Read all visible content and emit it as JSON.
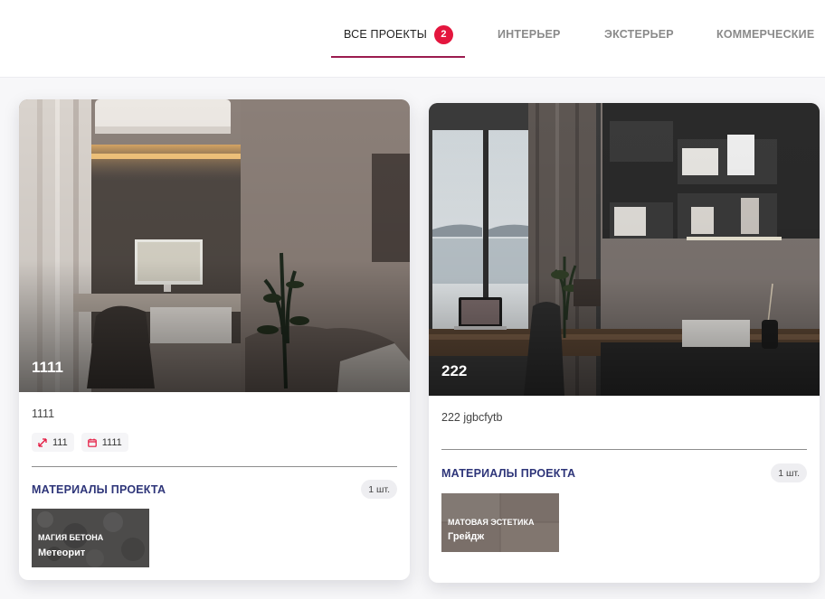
{
  "tabs": [
    {
      "label": "ВСЕ ПРОЕКТЫ",
      "badge": "2",
      "active": true
    },
    {
      "label": "ИНТЕРЬЕР"
    },
    {
      "label": "ЭКСТЕРЬЕР"
    },
    {
      "label": "КОММЕРЧЕСКИЕ"
    }
  ],
  "colors": {
    "accent": "#e4163e",
    "underline": "#9b1b4f",
    "materials_heading": "#2e3579"
  },
  "projects": [
    {
      "title": "1111",
      "description": "1111",
      "area": "111",
      "date": "1111",
      "materials_heading": "МАТЕРИАЛЫ ПРОЕКТА",
      "materials_count": "1 шт.",
      "material": {
        "collection": "МАГИЯ БЕТОНА",
        "name": "Метеорит"
      },
      "icons": [
        "expand-arrows-icon",
        "calendar-icon"
      ]
    },
    {
      "title": "222",
      "description": "222 jgbcfytb",
      "materials_heading": "МАТЕРИАЛЫ ПРОЕКТА",
      "materials_count": "1 шт.",
      "material": {
        "collection": "МАТОВАЯ ЭСТЕТИКА",
        "name": "Грейдж"
      }
    }
  ]
}
